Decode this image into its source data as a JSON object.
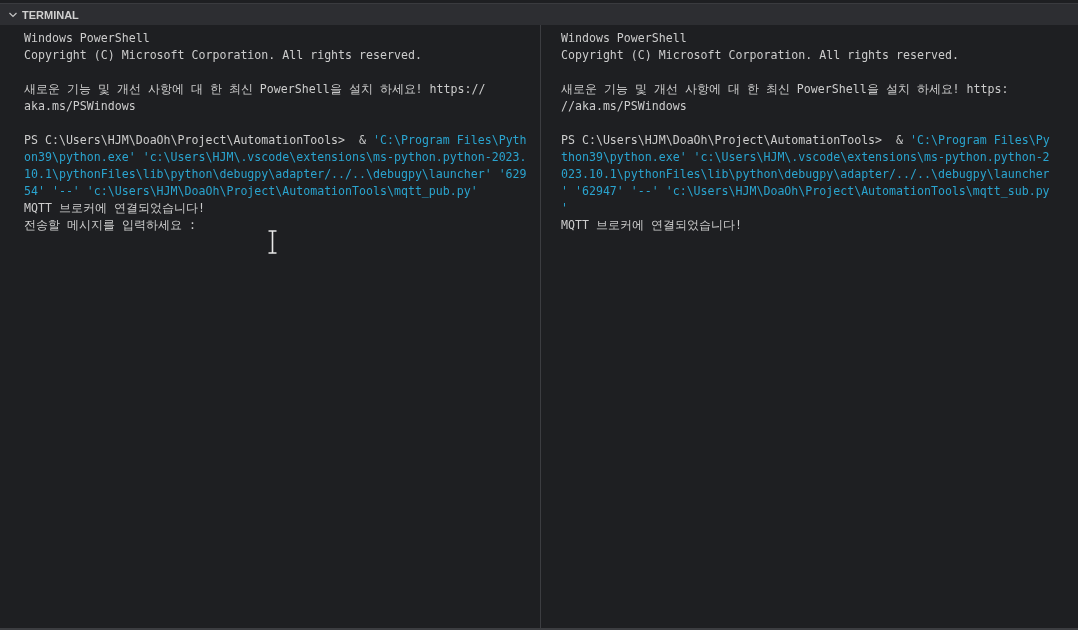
{
  "panel": {
    "title": "TERMINAL",
    "expanded": true
  },
  "panes": [
    {
      "blocks": [
        [
          [
            {
              "text": "Windows PowerShell",
              "kind": "plain"
            }
          ],
          [
            {
              "text": "Copyright (C) Microsoft Corporation. All rights reserved.",
              "kind": "plain"
            }
          ]
        ],
        [
          [
            {
              "text": "새로운 기능 및 개선 사항에 대 한 최신 PowerShell을 설치 하세요! https://",
              "kind": "plain"
            }
          ],
          [
            {
              "text": "aka.ms/PSWindows",
              "kind": "plain"
            }
          ]
        ],
        [
          [
            {
              "text": "PS C:\\Users\\HJM\\DoaOh\\Project\\AutomationTools>  & ",
              "kind": "plain"
            },
            {
              "text": "'C:\\Program Files\\Pyth",
              "kind": "string"
            }
          ],
          [
            {
              "text": "on39\\python.exe' 'c:\\Users\\HJM\\.vscode\\extensions\\ms-python.python-2023.",
              "kind": "string"
            }
          ],
          [
            {
              "text": "10.1\\pythonFiles\\lib\\python\\debugpy\\adapter/../..\\debugpy\\launcher' '629",
              "kind": "string"
            }
          ],
          [
            {
              "text": "54' '--' 'c:\\Users\\HJM\\DoaOh\\Project\\AutomationTools\\mqtt_pub.py'",
              "kind": "string"
            }
          ],
          [
            {
              "text": "MQTT 브로커에 연결되었습니다!",
              "kind": "plain"
            }
          ],
          [
            {
              "text": "전송할 메시지를 입력하세요 :",
              "kind": "plain"
            }
          ]
        ]
      ]
    },
    {
      "blocks": [
        [
          [
            {
              "text": "Windows PowerShell",
              "kind": "plain"
            }
          ],
          [
            {
              "text": "Copyright (C) Microsoft Corporation. All rights reserved.",
              "kind": "plain"
            }
          ]
        ],
        [
          [
            {
              "text": "새로운 기능 및 개선 사항에 대 한 최신 PowerShell을 설치 하세요! https:",
              "kind": "plain"
            }
          ],
          [
            {
              "text": "//aka.ms/PSWindows",
              "kind": "plain"
            }
          ]
        ],
        [
          [
            {
              "text": "PS C:\\Users\\HJM\\DoaOh\\Project\\AutomationTools>  & ",
              "kind": "plain"
            },
            {
              "text": "'C:\\Program Files\\Py",
              "kind": "string"
            }
          ],
          [
            {
              "text": "thon39\\python.exe' 'c:\\Users\\HJM\\.vscode\\extensions\\ms-python.python-2",
              "kind": "string"
            }
          ],
          [
            {
              "text": "023.10.1\\pythonFiles\\lib\\python\\debugpy\\adapter/../..\\debugpy\\launcher",
              "kind": "string"
            }
          ],
          [
            {
              "text": "' '62947' '--' 'c:\\Users\\HJM\\DoaOh\\Project\\AutomationTools\\mqtt_sub.py",
              "kind": "string"
            }
          ],
          [
            {
              "text": "'",
              "kind": "string"
            }
          ],
          [
            {
              "text": "MQTT 브로커에 연결되었습니다!",
              "kind": "plain"
            }
          ]
        ]
      ]
    }
  ]
}
